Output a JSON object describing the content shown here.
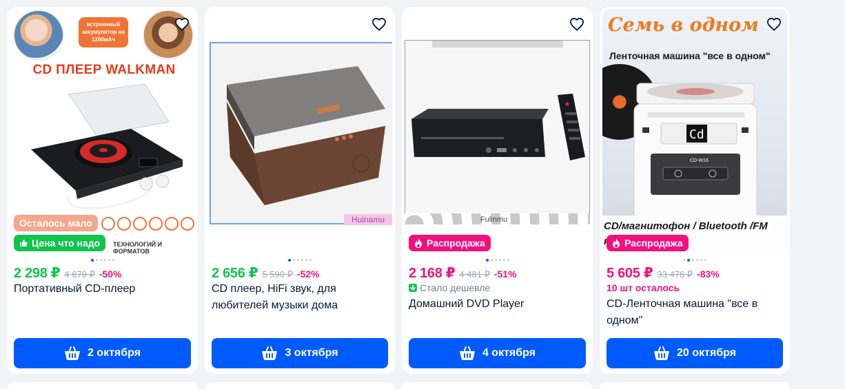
{
  "products": [
    {
      "image_texts": {
        "battery_badge": "встроенный аккумулятор на 1200мАч",
        "headline": "CD ПЛЕЕР WALKMAN",
        "formats_caption": "ТЕХНОЛОГИЙ И ФОРМАТОВ"
      },
      "badges": [
        "Осталось мало",
        "Цена что надо"
      ],
      "price": "2 298 ₽",
      "old_price": "4 679 ₽",
      "discount": "-50%",
      "title": "Портативный CD-плеер",
      "delivery": "2 октября",
      "images_count": 6,
      "active_image": 1
    },
    {
      "image_texts": {
        "watermark": "Huinamu"
      },
      "price": "2 656 ₽",
      "old_price": "5 590 ₽",
      "discount": "-52%",
      "title": "CD плеер, HiFi звук, для любителей музыки дома",
      "delivery": "3 октября",
      "images_count": 6,
      "active_image": 1
    },
    {
      "image_texts": {
        "watermark": "Fulinmu"
      },
      "badges": [
        "Распродажа"
      ],
      "price": "2 168 ₽",
      "old_price": "4 481 ₽",
      "discount": "-51%",
      "meta": "Стало дешевле",
      "title": "Домашний DVD Player",
      "delivery": "4 октября",
      "images_count": 6,
      "active_image": 1
    },
    {
      "image_texts": {
        "headline": "Семь в одном",
        "subheadline": "Ленточная машина \"все в одном\"",
        "device_label": "CD-W16",
        "caption": "CD/магнитофон / Bluetooth /FM карта/AUX"
      },
      "badges": [
        "Распродажа"
      ],
      "price": "5 605 ₽",
      "old_price": "33 476 ₽",
      "discount": "-83%",
      "meta": "10 шт осталось",
      "title": "CD-Ленточная машина \"все в одном\"",
      "delivery": "20 октября",
      "images_count": 6,
      "active_image": 2
    }
  ],
  "colors": {
    "brand_blue": "#005bff",
    "price_green": "#10c44c",
    "sale_pink": "#f1117e",
    "page_bg": "#f2f3f5"
  },
  "icons": {
    "favorite": "heart-outline-icon",
    "delivery": "basket-icon",
    "good_price": "thumbs-up-icon",
    "sale": "flame-icon",
    "price_down": "arrow-down-icon"
  }
}
